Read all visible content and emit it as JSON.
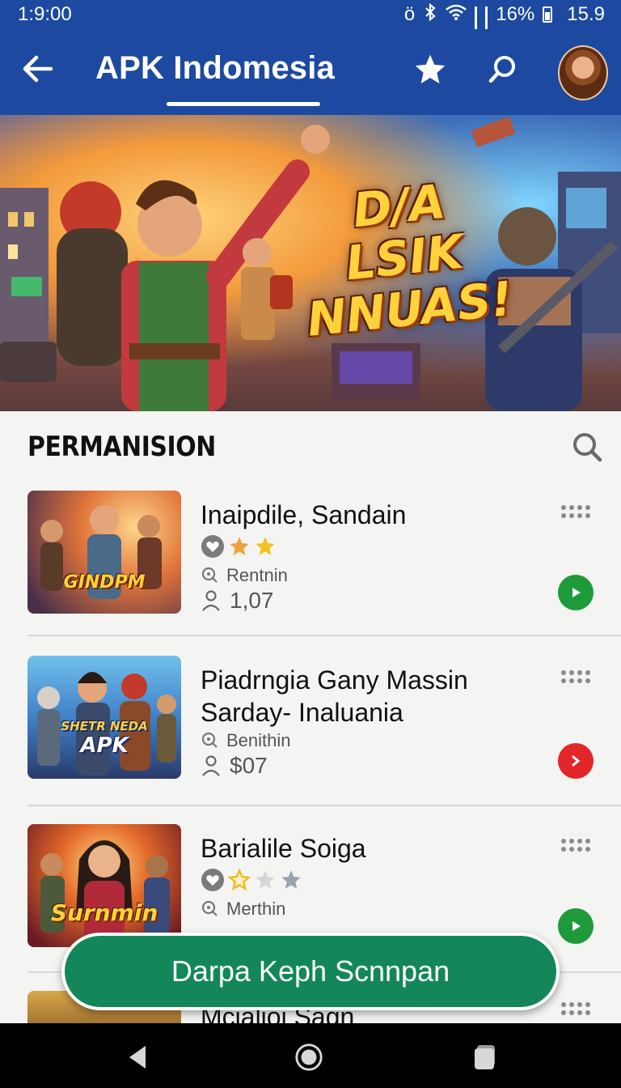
{
  "status_bar": {
    "time": "1:9:00",
    "alarm_glyph": "ö",
    "battery_text": "16%",
    "extra_text": "15.9"
  },
  "app_bar": {
    "title": "APK Indomesia",
    "icons": [
      "back-arrow-icon",
      "star-icon",
      "search-icon",
      "avatar"
    ]
  },
  "hero": {
    "title_line1": "D/A LSIK",
    "title_line2": "NNUAS!"
  },
  "section": {
    "title": "PERMANISION"
  },
  "items": [
    {
      "name": "Inaipdile, Sandain",
      "thumb_text": "GINDPM",
      "stars": "2 of 3",
      "category": "Rentnin",
      "price": "1,07",
      "action_color": "#1e9a3b"
    },
    {
      "name": "Piadrngia Gany Massin Sarday- Inaluania",
      "thumb_text_top": "SHETR NEDA",
      "thumb_text": "APK",
      "category": "Benithin",
      "price": "$07",
      "action_color": "#e2262a"
    },
    {
      "name": "Barialile Soiga",
      "thumb_text": "Surnmin",
      "stars": "1 of 3",
      "category": "Merthin",
      "action_color": "#1e9a3b"
    },
    {
      "name": "Mcialioi Sagn"
    }
  ],
  "fab": {
    "label": "Darpa Keph Scnnpan"
  },
  "colors": {
    "app_bar": "#1d4aa0",
    "fab": "#13875a",
    "star": "#f2b81f"
  }
}
